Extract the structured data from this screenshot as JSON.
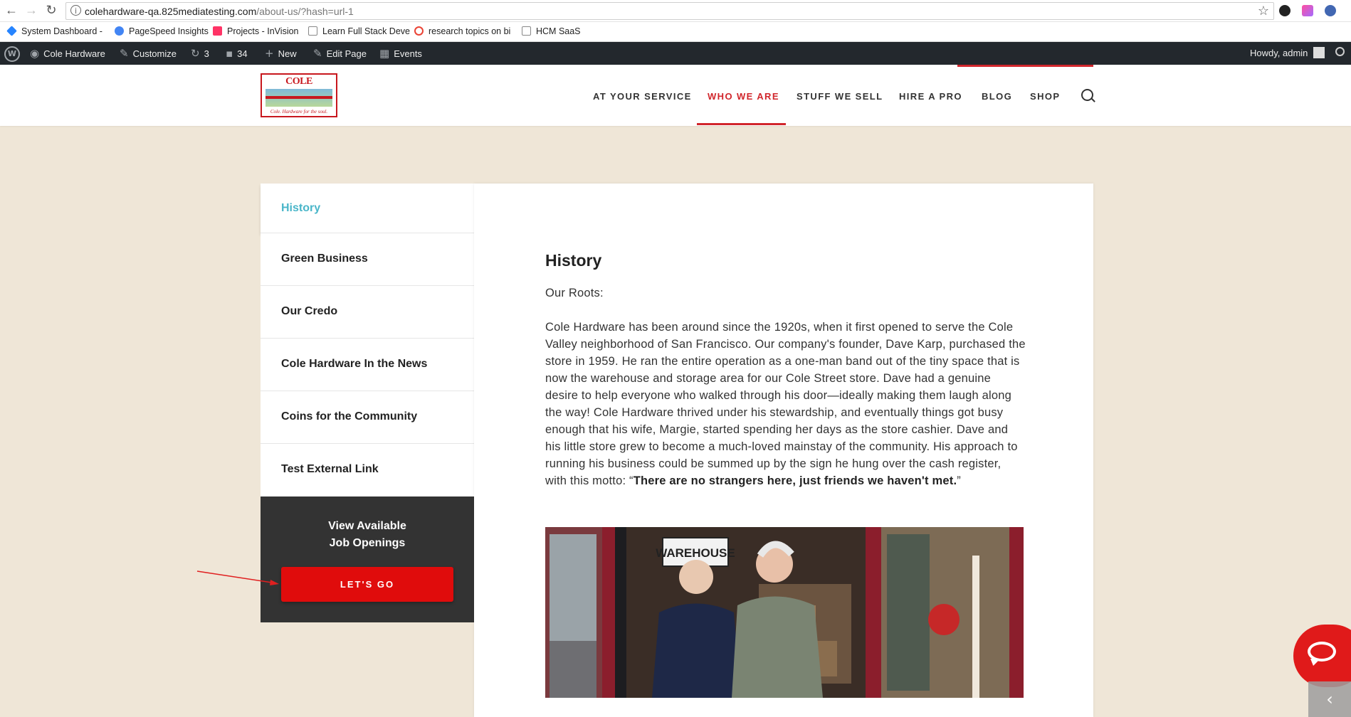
{
  "browser": {
    "url_host": "colehardware-qa.825mediatesting.com",
    "url_path": "/about-us/?hash=url-1",
    "bookmarks": [
      {
        "label": "System Dashboard - ",
        "color": "#2684ff"
      },
      {
        "label": "PageSpeed Insights",
        "color": "#4285f4"
      },
      {
        "label": "Projects - InVision",
        "color": "#ff3366"
      },
      {
        "label": "Learn Full Stack Deve",
        "color": "#888888"
      },
      {
        "label": "research topics on bi",
        "color": "#ea4335"
      },
      {
        "label": "HCM SaaS",
        "color": "#888888"
      }
    ]
  },
  "admin_bar": {
    "site_name": "Cole Hardware",
    "customize": "Customize",
    "updates_count": "3",
    "comments_count": "34",
    "new_label": "New",
    "edit_page": "Edit Page",
    "events": "Events",
    "howdy": "Howdy, admin"
  },
  "header": {
    "logo_title": "COLE HARDWARE",
    "logo_tagline": "Cole. Hardware for the soul.",
    "nav": [
      "AT YOUR SERVICE",
      "WHO WE ARE",
      "STUFF WE SELL",
      "HIRE A PRO",
      "BLOG",
      "SHOP"
    ],
    "active_nav": "WHO WE ARE"
  },
  "sidebar": {
    "items": [
      "History",
      "Green Business",
      "Our Credo",
      "Cole Hardware In the News",
      "Coins for the Community",
      "Test External Link"
    ],
    "active": "History",
    "jobs_line1": "View Available",
    "jobs_line2": "Job Openings",
    "cta_label": "LET'S GO"
  },
  "content": {
    "title": "History",
    "intro": "Our Roots:",
    "body": "Cole Hardware has been around since the 1920s, when it first opened to serve the Cole Valley neighborhood of San Francisco. Our company's founder, Dave Karp, purchased the store in 1959. He ran the entire operation as a one-man band out of the tiny space that is now the warehouse and storage area for our Cole Street store. Dave had a genuine desire to help everyone who walked through his door—ideally making them laugh along the way! Cole Hardware thrived under his stewardship, and eventually things got busy enough that his wife, Margie, started spending her days as the store cashier. Dave and his little store grew to become a much-loved mainstay of the community. His approach to running his business could be summed up by the sign he hung over the cash register, with this motto: “",
    "motto": "There are no strangers here, just friends we haven't met.",
    "closing_quote": "”",
    "photo_sign": "WAREHOUSE"
  },
  "colors": {
    "accent_red": "#d1262c",
    "active_teal": "#4ab6c9",
    "cta_red": "#e00c0c",
    "page_bg": "#efe6d7"
  }
}
